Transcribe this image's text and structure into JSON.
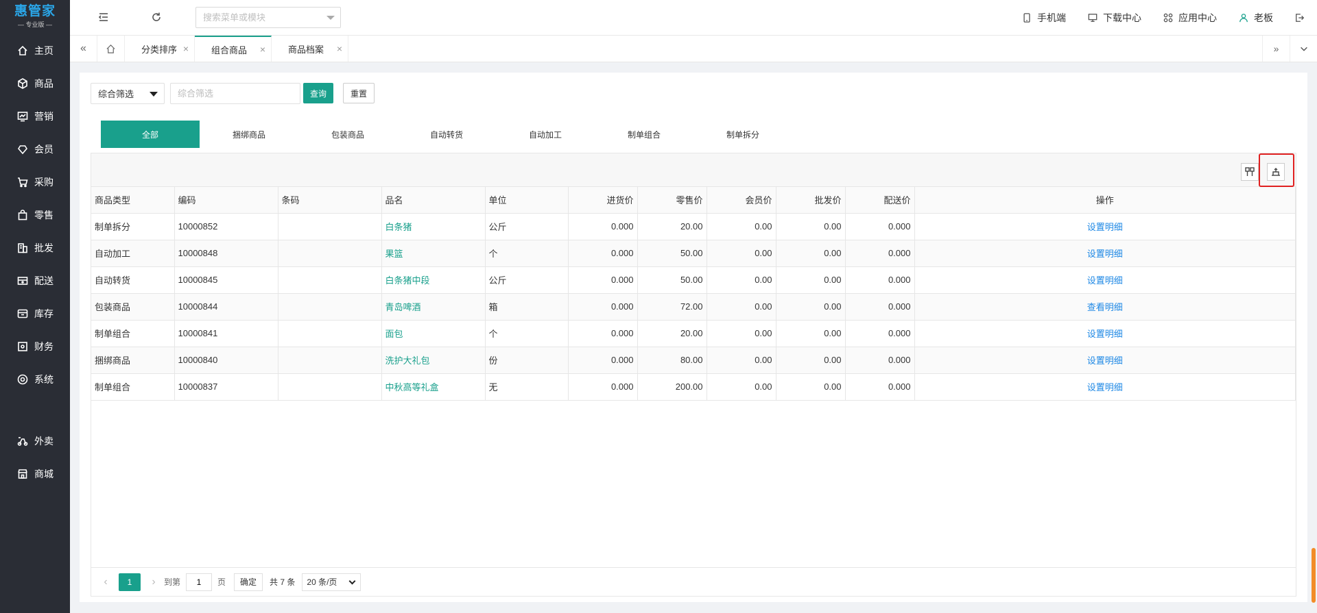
{
  "app": {
    "brand": "惠管家",
    "edition": "专业版"
  },
  "sidebar": {
    "items": [
      {
        "label": "主页",
        "icon": "home-icon"
      },
      {
        "label": "商品",
        "icon": "cube-icon"
      },
      {
        "label": "营销",
        "icon": "chart-icon"
      },
      {
        "label": "会员",
        "icon": "diamond-icon"
      },
      {
        "label": "采购",
        "icon": "cart-icon"
      },
      {
        "label": "零售",
        "icon": "bag-icon"
      },
      {
        "label": "批发",
        "icon": "building-icon"
      },
      {
        "label": "配送",
        "icon": "truck-icon"
      },
      {
        "label": "库存",
        "icon": "box-icon"
      },
      {
        "label": "财务",
        "icon": "ledger-icon"
      },
      {
        "label": "系统",
        "icon": "target-icon"
      }
    ],
    "extra_items": [
      {
        "label": "外卖",
        "icon": "scooter-icon"
      },
      {
        "label": "商城",
        "icon": "store-icon"
      }
    ]
  },
  "topbar": {
    "search_placeholder": "搜索菜单或模块",
    "links": [
      {
        "label": "手机端",
        "icon": "phone-icon"
      },
      {
        "label": "下载中心",
        "icon": "download-icon"
      },
      {
        "label": "应用中心",
        "icon": "apps-icon"
      },
      {
        "label": "老板",
        "icon": "user-icon"
      }
    ]
  },
  "tabs": [
    {
      "label": "分类排序",
      "active": false
    },
    {
      "label": "组合商品",
      "active": true
    },
    {
      "label": "商品档案",
      "active": false
    }
  ],
  "filter": {
    "select_value": "综合筛选",
    "input_placeholder": "综合筛选",
    "query_label": "查询",
    "reset_label": "重置"
  },
  "type_tabs": [
    "全部",
    "捆绑商品",
    "包装商品",
    "自动转货",
    "自动加工",
    "制单组合",
    "制单拆分"
  ],
  "table": {
    "headers": [
      "商品类型",
      "编码",
      "条码",
      "品名",
      "单位",
      "进货价",
      "零售价",
      "会员价",
      "批发价",
      "配送价",
      "操作"
    ],
    "rows": [
      {
        "type": "制单拆分",
        "code": "10000852",
        "barcode": "",
        "name": "白条猪",
        "unit": "公斤",
        "purchase": "0.000",
        "retail": "20.00",
        "member": "0.00",
        "wholesale": "0.00",
        "delivery": "0.000",
        "op": "设置明细"
      },
      {
        "type": "自动加工",
        "code": "10000848",
        "barcode": "",
        "name": "果篮",
        "unit": "个",
        "purchase": "0.000",
        "retail": "50.00",
        "member": "0.00",
        "wholesale": "0.00",
        "delivery": "0.000",
        "op": "设置明细"
      },
      {
        "type": "自动转货",
        "code": "10000845",
        "barcode": "",
        "name": "白条猪中段",
        "unit": "公斤",
        "purchase": "0.000",
        "retail": "50.00",
        "member": "0.00",
        "wholesale": "0.00",
        "delivery": "0.000",
        "op": "设置明细"
      },
      {
        "type": "包装商品",
        "code": "10000844",
        "barcode": "",
        "name": "青岛啤酒",
        "unit": "箱",
        "purchase": "0.000",
        "retail": "72.00",
        "member": "0.00",
        "wholesale": "0.00",
        "delivery": "0.000",
        "op": "查看明细"
      },
      {
        "type": "制单组合",
        "code": "10000841",
        "barcode": "",
        "name": "面包",
        "unit": "个",
        "purchase": "0.000",
        "retail": "20.00",
        "member": "0.00",
        "wholesale": "0.00",
        "delivery": "0.000",
        "op": "设置明细"
      },
      {
        "type": "捆绑商品",
        "code": "10000840",
        "barcode": "",
        "name": "洗护大礼包",
        "unit": "份",
        "purchase": "0.000",
        "retail": "80.00",
        "member": "0.00",
        "wholesale": "0.00",
        "delivery": "0.000",
        "op": "设置明细"
      },
      {
        "type": "制单组合",
        "code": "10000837",
        "barcode": "",
        "name": "中秋高等礼盒",
        "unit": "无",
        "purchase": "0.000",
        "retail": "200.00",
        "member": "0.00",
        "wholesale": "0.00",
        "delivery": "0.000",
        "op": "设置明细"
      }
    ]
  },
  "pager": {
    "current_page": "1",
    "goto_prefix": "到第",
    "goto_value": "1",
    "goto_suffix": "页",
    "confirm_label": "确定",
    "total_text": "共 7 条",
    "page_size": "20 条/页"
  },
  "colors": {
    "sidebar_bg": "#2a2d35",
    "brand_blue": "#2aa6e8",
    "primary": "#19a08c",
    "link_blue": "#1e88e5",
    "highlight_red": "#e02020"
  }
}
